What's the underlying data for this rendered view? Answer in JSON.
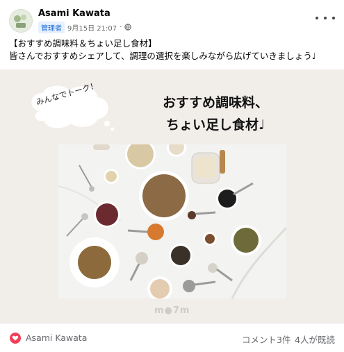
{
  "post": {
    "author": "Asami Kawata",
    "role_badge": "管理者",
    "timestamp": "9月15日 21:07",
    "separator": "·",
    "privacy_icon": "globe-icon",
    "body_lines": [
      "【おすすめ調味料＆ちょい足し食材】",
      "皆さんでおすすめシェアして、調理の選択を楽しみながら広げていきましょう♩"
    ]
  },
  "image": {
    "bubble_text": "みんなでトーク！",
    "headline_lines": [
      "おすすめ調味料、",
      "ちょい足し食材♩"
    ],
    "watermark": "m●7m"
  },
  "footer": {
    "reaction_icon": "heart-icon",
    "reaction_user": "Asami Kawata",
    "comments": "コメント3件",
    "seen": "4人が既読"
  },
  "colors": {
    "badge_bg": "#e7f0fd",
    "badge_text": "#1b6ad8",
    "heart": "#f33e58",
    "media_bg": "#f1eeea"
  }
}
